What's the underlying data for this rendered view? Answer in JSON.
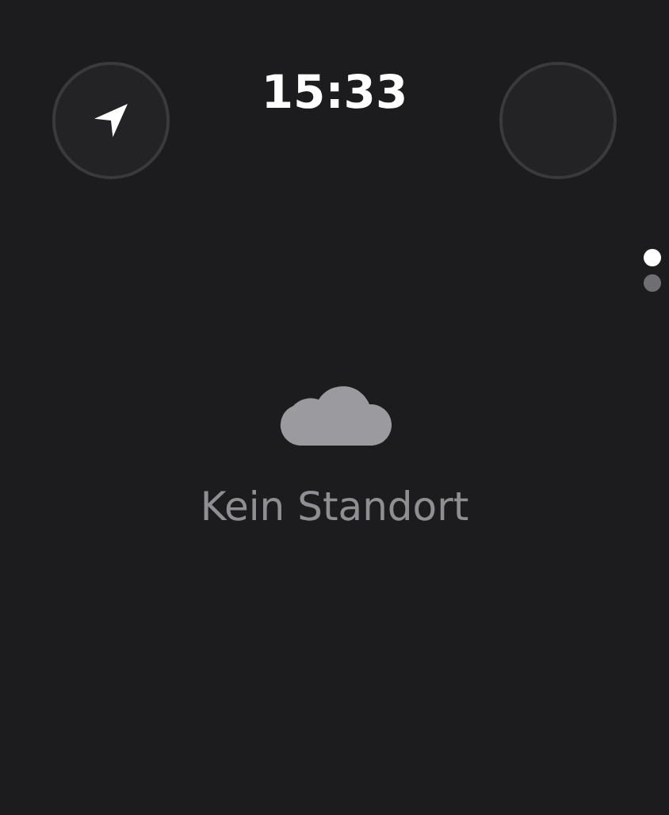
{
  "status_bar": {
    "time": "15:33"
  },
  "page_dots": [
    {
      "selected": true
    },
    {
      "selected": false
    }
  ],
  "message": {
    "text": "Kein Standort"
  }
}
